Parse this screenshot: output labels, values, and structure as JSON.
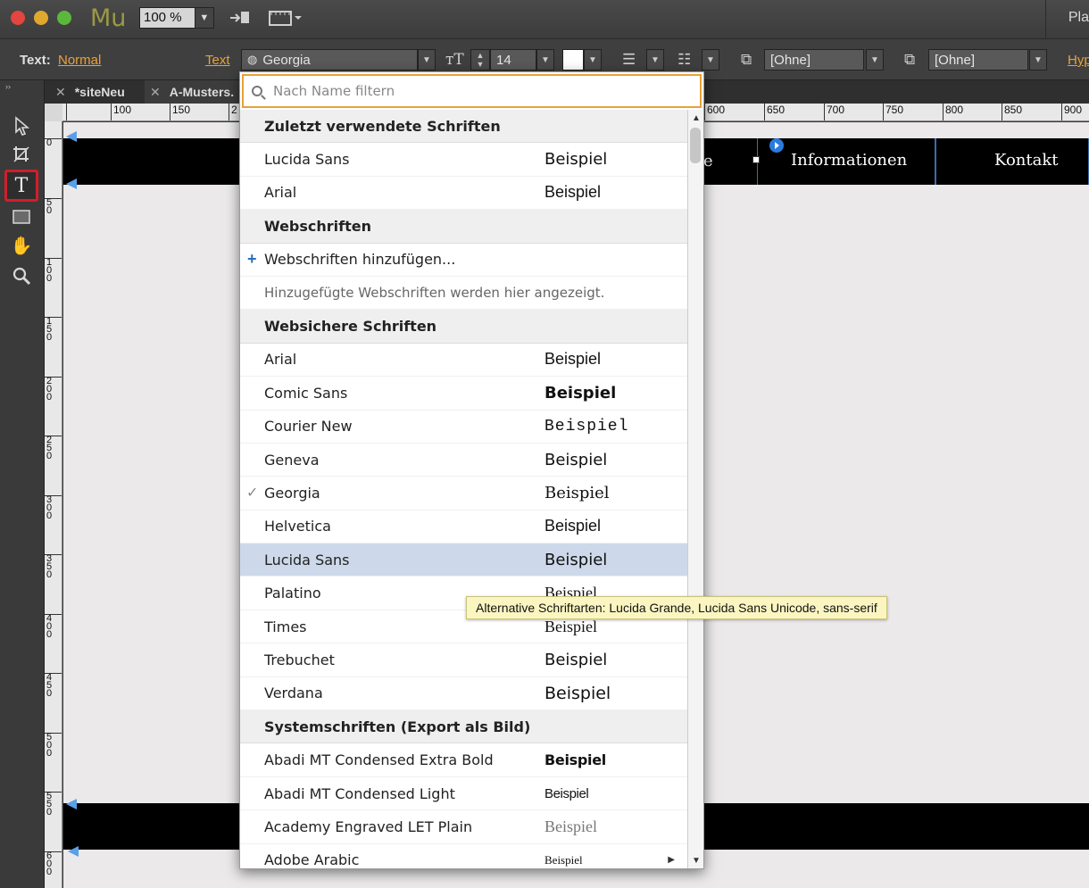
{
  "app": {
    "logo": "Mu",
    "zoom": "100 %",
    "right_text": "Pla"
  },
  "controlbar": {
    "text_label": "Text:",
    "style_link": "Normal",
    "text_link": "Text",
    "font_value": "Georgia",
    "size_value": "14",
    "para_style_1": "[Ohne]",
    "para_style_2": "[Ohne]",
    "hyp_link": "Hyp"
  },
  "tabs": [
    {
      "label": "*siteNeu"
    },
    {
      "label": "A-Musters."
    }
  ],
  "ruler": {
    "h_ticks": [
      "100",
      "150",
      "2",
      "600",
      "650",
      "700",
      "750",
      "800",
      "850",
      "900"
    ],
    "v_ticks": [
      "0",
      "5\n0",
      "1\n0\n0",
      "1\n5\n0",
      "2\n0\n0",
      "2\n5\n0",
      "3\n0\n0",
      "3\n5\n0",
      "4\n0\n0",
      "4\n5\n0",
      "5\n0\n0",
      "5\n5\n0",
      "6\n0\n0"
    ]
  },
  "canvas": {
    "nav_fragment": "e",
    "nav_items": [
      "Informationen",
      "Kontakt"
    ]
  },
  "dropdown": {
    "search_placeholder": "Nach Name filtern",
    "sections": [
      {
        "title": "Zuletzt verwendete Schriften",
        "items": [
          {
            "name": "Lucida Sans",
            "sample": "Beispiel"
          },
          {
            "name": "Arial",
            "sample": "Beispiel"
          }
        ]
      },
      {
        "title": "Webschriften",
        "add_label": "Webschriften hinzufügen...",
        "note": "Hinzugefügte Webschriften werden hier angezeigt."
      },
      {
        "title": "Websichere Schriften",
        "items": [
          {
            "name": "Arial",
            "sample": "Beispiel"
          },
          {
            "name": "Comic Sans",
            "sample": "Beispiel"
          },
          {
            "name": "Courier New",
            "sample": "Beispiel"
          },
          {
            "name": "Geneva",
            "sample": "Beispiel"
          },
          {
            "name": "Georgia",
            "sample": "Beispiel",
            "checked": true
          },
          {
            "name": "Helvetica",
            "sample": "Beispiel"
          },
          {
            "name": "Lucida Sans",
            "sample": "Beispiel",
            "highlighted": true
          },
          {
            "name": "Palatino",
            "sample": "Beispiel"
          },
          {
            "name": "Times",
            "sample": "Beispiel"
          },
          {
            "name": "Trebuchet",
            "sample": "Beispiel"
          },
          {
            "name": "Verdana",
            "sample": "Beispiel"
          }
        ]
      },
      {
        "title": "Systemschriften (Export als Bild)",
        "items": [
          {
            "name": "Abadi MT Condensed Extra Bold",
            "sample": "Beispiel"
          },
          {
            "name": "Abadi MT Condensed Light",
            "sample": "Beispiel"
          },
          {
            "name": "Academy Engraved LET Plain",
            "sample": "Beispiel"
          },
          {
            "name": "Adobe Arabic",
            "sample": "Beispiel",
            "has_submenu": true
          }
        ]
      }
    ],
    "tooltip": "Alternative Schriftarten: Lucida Grande, Lucida Sans Unicode, sans-serif"
  },
  "colors": {
    "accent_orange": "#e8a13a",
    "highlight_row": "#cdd9ea",
    "selected_tool_border": "#d21e2a"
  }
}
